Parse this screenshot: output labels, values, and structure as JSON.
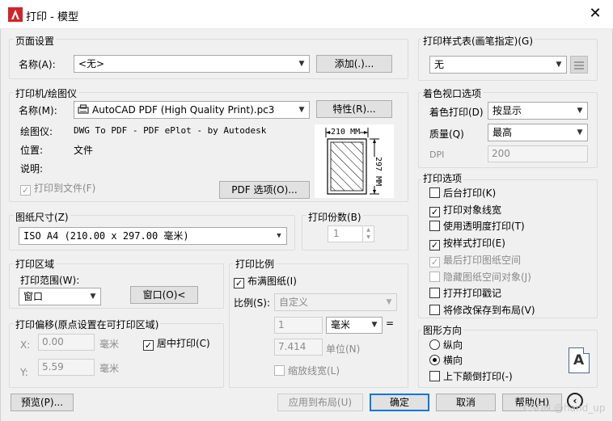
{
  "window": {
    "title": "打印 - 模型",
    "close_glyph": "✕"
  },
  "page_setup": {
    "group_label": "页面设置",
    "name_label": "名称(A):",
    "name_value": "<无>",
    "add_button": "添加(.)..."
  },
  "printer": {
    "group_label": "打印机/绘图仪",
    "name_label": "名称(M):",
    "name_value": "AutoCAD PDF (High Quality Print).pc3",
    "properties_button": "特性(R)...",
    "plotter_label": "绘图仪:",
    "plotter_value": "DWG To PDF - PDF ePlot - by Autodesk",
    "location_label": "位置:",
    "location_value": "文件",
    "description_label": "说明:",
    "print_to_file": "打印到文件(F)",
    "print_to_file_checked": true,
    "pdf_options_button": "PDF 选项(O)...",
    "preview_width": "210 MM",
    "preview_height": "297 MM"
  },
  "paper_size": {
    "group_label": "图纸尺寸(Z)",
    "value": "ISO A4 (210.00 x 297.00 毫米)"
  },
  "copies": {
    "group_label": "打印份数(B)",
    "value": "1"
  },
  "plot_area": {
    "group_label": "打印区域",
    "range_label": "打印范围(W):",
    "range_value": "窗口",
    "window_button": "窗口(O)<"
  },
  "plot_offset": {
    "group_label": "打印偏移(原点设置在可打印区域)",
    "x_label": "X:",
    "x_value": "0.00",
    "x_unit": "毫米",
    "y_label": "Y:",
    "y_value": "5.59",
    "y_unit": "毫米",
    "center_plot": "居中打印(C)",
    "center_plot_checked": true
  },
  "plot_scale": {
    "group_label": "打印比例",
    "fit_to_paper": "布满图纸(I)",
    "fit_to_paper_checked": true,
    "scale_label": "比例(S):",
    "scale_value": "自定义",
    "value1": "1",
    "unit_value": "毫米",
    "equals": "=",
    "value2": "7.414",
    "unit_label": "单位(N)",
    "scale_lineweights": "缩放线宽(L)"
  },
  "plot_style_table": {
    "group_label": "打印样式表(画笔指定)(G)",
    "value": "无"
  },
  "shaded_viewport": {
    "group_label": "着色视口选项",
    "shade_label": "着色打印(D)",
    "shade_value": "按显示",
    "quality_label": "质量(Q)",
    "quality_value": "最高",
    "dpi_label": "DPI",
    "dpi_value": "200"
  },
  "plot_options": {
    "group_label": "打印选项",
    "items": [
      {
        "label": "后台打印(K)",
        "checked": false,
        "enabled": true
      },
      {
        "label": "打印对象线宽",
        "checked": true,
        "enabled": true
      },
      {
        "label": "使用透明度打印(T)",
        "checked": false,
        "enabled": true
      },
      {
        "label": "按样式打印(E)",
        "checked": true,
        "enabled": true
      },
      {
        "label": "最后打印图纸空间",
        "checked": true,
        "enabled": false
      },
      {
        "label": "隐藏图纸空间对象(J)",
        "checked": false,
        "enabled": false
      },
      {
        "label": "打开打印戳记",
        "checked": false,
        "enabled": true
      },
      {
        "label": "将修改保存到布局(V)",
        "checked": false,
        "enabled": true
      }
    ]
  },
  "orientation": {
    "group_label": "图形方向",
    "portrait": "纵向",
    "landscape": "横向",
    "selected": "landscape",
    "upside_down": "上下颠倒打印(-)",
    "icon_letter": "A"
  },
  "footer": {
    "preview_button": "预览(P)...",
    "apply_layout_button": "应用到布局(U)",
    "ok_button": "确定",
    "cancel_button": "取消",
    "help_button": "帮助(H)",
    "watermark": "CSDN @hand_up"
  },
  "colors": {
    "accent": "#0078d7",
    "app_icon_red": "#d3232a"
  }
}
